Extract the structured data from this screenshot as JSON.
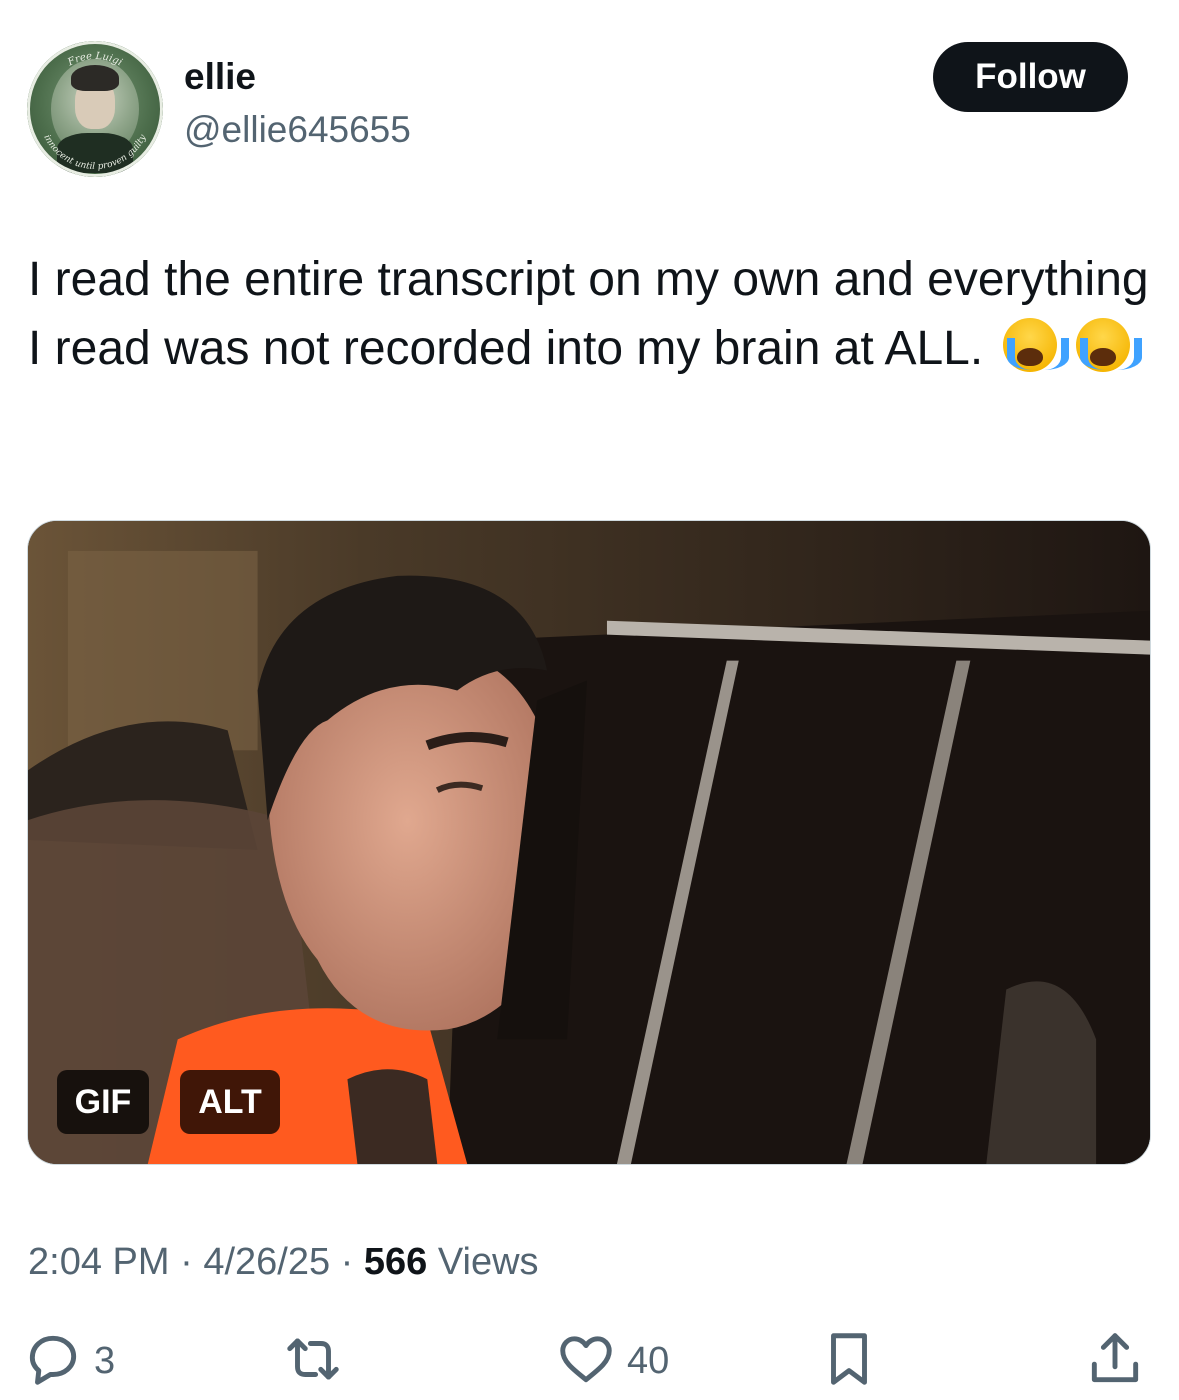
{
  "author": {
    "name": "ellie",
    "handle": "@ellie645655",
    "avatar_caption_top": "Free Luigi",
    "avatar_caption_bottom": "innocent until proven guilty"
  },
  "follow_label": "Follow",
  "tweet": {
    "text": "I read the entire transcript on my own and everything I read was not recorded into my brain at ALL.",
    "emojis": [
      "loudly-crying-face-icon",
      "loudly-crying-face-icon"
    ]
  },
  "media": {
    "type": "gif",
    "gif_badge": "GIF",
    "alt_badge": "ALT"
  },
  "meta": {
    "time": "2:04 PM",
    "sep1": " · ",
    "date": "4/26/25",
    "sep2": " · ",
    "views_count": "566",
    "views_label": " Views"
  },
  "actions": {
    "reply_count": "3",
    "retweet_count": "",
    "like_count": "40",
    "icons": [
      "reply-icon",
      "retweet-icon",
      "like-icon",
      "bookmark-icon",
      "share-icon"
    ]
  },
  "colors": {
    "text_primary": "#0f1419",
    "text_secondary": "#536471",
    "follow_bg": "#0f1419",
    "avatar_green": "#4d6e4c"
  }
}
